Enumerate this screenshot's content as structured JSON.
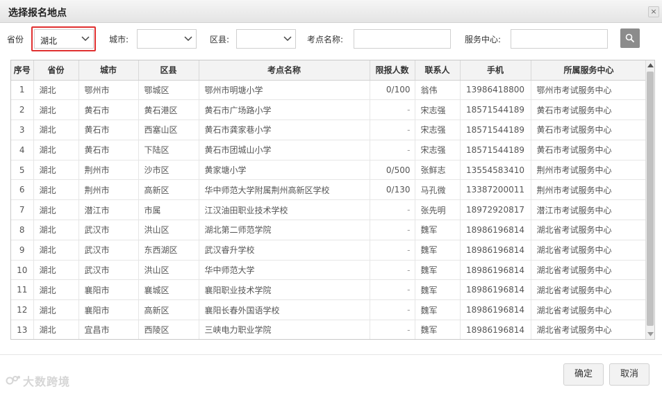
{
  "dialog": {
    "title": "选择报名地点",
    "close_icon": "close-icon"
  },
  "filters": {
    "province_label": "省份",
    "province_value": "湖北",
    "city_label": "城市:",
    "city_value": "",
    "district_label": "区县:",
    "district_value": "",
    "site_name_label": "考点名称:",
    "site_name_value": "",
    "service_center_label": "服务中心:",
    "service_center_value": "",
    "search_icon": "search-icon"
  },
  "table": {
    "headers": [
      "序号",
      "省份",
      "城市",
      "区县",
      "考点名称",
      "限报人数",
      "联系人",
      "手机",
      "所属服务中心"
    ],
    "rows": [
      [
        "1",
        "湖北",
        "鄂州市",
        "鄂城区",
        "鄂州市明塘小学",
        "0/100",
        "翁伟",
        "13986418800",
        "鄂州市考试服务中心"
      ],
      [
        "2",
        "湖北",
        "黄石市",
        "黄石港区",
        "黄石市广场路小学",
        "-",
        "宋志强",
        "18571544189",
        "黄石市考试服务中心"
      ],
      [
        "3",
        "湖北",
        "黄石市",
        "西塞山区",
        "黄石市龚家巷小学",
        "-",
        "宋志强",
        "18571544189",
        "黄石市考试服务中心"
      ],
      [
        "4",
        "湖北",
        "黄石市",
        "下陆区",
        "黄石市团城山小学",
        "-",
        "宋志强",
        "18571544189",
        "黄石市考试服务中心"
      ],
      [
        "5",
        "湖北",
        "荆州市",
        "沙市区",
        "黄家塘小学",
        "0/500",
        "张鲜志",
        "13554583410",
        "荆州市考试服务中心"
      ],
      [
        "6",
        "湖北",
        "荆州市",
        "高新区",
        "华中师范大学附属荆州高新区学校",
        "0/130",
        "马孔微",
        "13387200011",
        "荆州市考试服务中心"
      ],
      [
        "7",
        "湖北",
        "潜江市",
        "市属",
        "江汉油田职业技术学校",
        "-",
        "张先明",
        "18972920817",
        "潜江市考试服务中心"
      ],
      [
        "8",
        "湖北",
        "武汉市",
        "洪山区",
        "湖北第二师范学院",
        "-",
        "魏军",
        "18986196814",
        "湖北省考试服务中心"
      ],
      [
        "9",
        "湖北",
        "武汉市",
        "东西湖区",
        "武汉睿升学校",
        "-",
        "魏军",
        "18986196814",
        "湖北省考试服务中心"
      ],
      [
        "10",
        "湖北",
        "武汉市",
        "洪山区",
        "华中师范大学",
        "-",
        "魏军",
        "18986196814",
        "湖北省考试服务中心"
      ],
      [
        "11",
        "湖北",
        "襄阳市",
        "襄城区",
        "襄阳职业技术学院",
        "-",
        "魏军",
        "18986196814",
        "湖北省考试服务中心"
      ],
      [
        "12",
        "湖北",
        "襄阳市",
        "高新区",
        "襄阳长春外国语学校",
        "-",
        "魏军",
        "18986196814",
        "湖北省考试服务中心"
      ],
      [
        "13",
        "湖北",
        "宜昌市",
        "西陵区",
        "三峡电力职业学院",
        "-",
        "魏军",
        "18986196814",
        "湖北省考试服务中心"
      ]
    ]
  },
  "footer": {
    "confirm_label": "确定",
    "cancel_label": "取消",
    "watermark_text": "大数跨境"
  },
  "colors": {
    "highlight": "#e03030",
    "search_button": "#8c8c8c"
  }
}
